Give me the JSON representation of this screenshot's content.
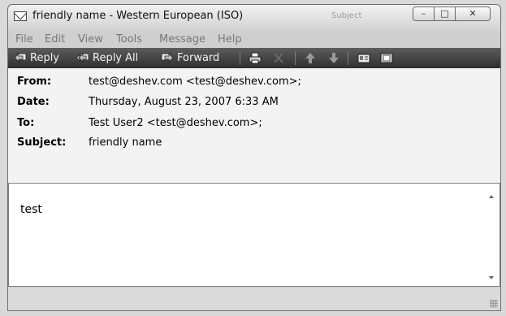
{
  "window": {
    "title": "friendly name - Western European (ISO)",
    "ghost_label": "Subject",
    "controls": {
      "minimize": "–",
      "maximize": "□",
      "close": "✕"
    }
  },
  "menu": [
    "File",
    "Edit",
    "View",
    "Tools",
    "Message",
    "Help"
  ],
  "toolbar": {
    "reply": "Reply",
    "reply_all": "Reply All",
    "forward": "Forward",
    "icons": [
      "reply-icon",
      "reply-all-icon",
      "forward-icon",
      "print-icon",
      "delete-icon",
      "previous-icon",
      "next-icon",
      "address-book-icon",
      "view-icon"
    ]
  },
  "headers": [
    {
      "label": "From:",
      "value": "test@deshev.com <test@deshev.com>;"
    },
    {
      "label": "Date:",
      "value": "Thursday, August 23, 2007 6:33 AM"
    },
    {
      "label": "To:",
      "value": "Test User2 <test@deshev.com>;"
    },
    {
      "label": "Subject:",
      "value": "friendly name"
    }
  ],
  "body": {
    "text": "test"
  }
}
